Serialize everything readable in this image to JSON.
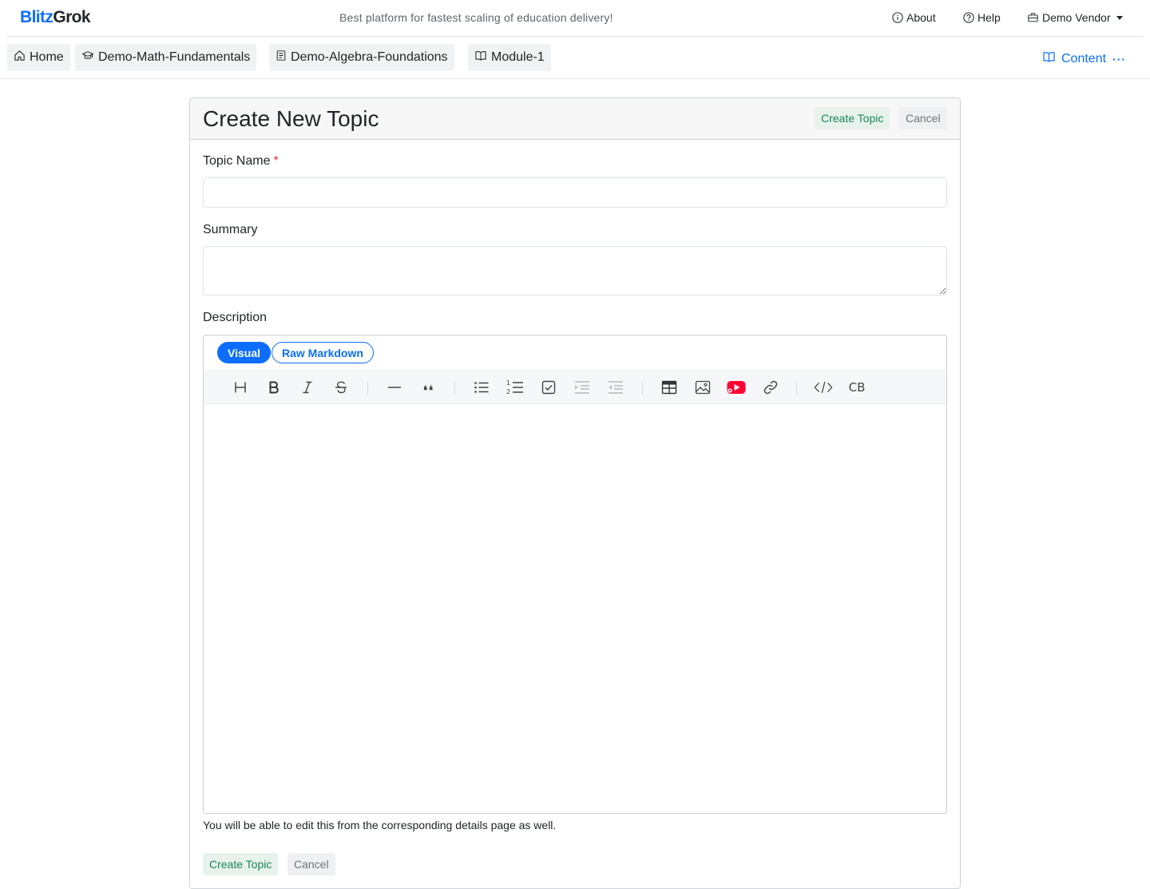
{
  "brand": {
    "part1": "Blitz",
    "part2": "Grok"
  },
  "tagline": "Best platform for fastest scaling of education delivery!",
  "topnav": {
    "about": "About",
    "help": "Help",
    "user": "Demo Vendor"
  },
  "breadcrumbs": [
    "Home",
    "Demo-Math-Fundamentals",
    "Demo-Algebra-Foundations",
    "Module-1"
  ],
  "content_menu": {
    "label": "Content",
    "more": "···"
  },
  "form": {
    "title": "Create New Topic",
    "create_label": "Create Topic",
    "cancel_label": "Cancel",
    "topic_name_label": "Topic Name",
    "required_mark": "*",
    "topic_name_value": "",
    "summary_label": "Summary",
    "summary_value": "",
    "description_label": "Description",
    "help_text": "You will be able to edit this from the corresponding details page as well."
  },
  "editor": {
    "tabs": [
      "Visual",
      "Raw Markdown"
    ],
    "active_tab": "Visual",
    "toolbar_icons": [
      "heading-icon",
      "bold-icon",
      "italic-icon",
      "strike-icon",
      "hr-icon",
      "quote-icon",
      "bullet-list-icon",
      "ordered-list-icon",
      "task-list-icon",
      "indent-icon",
      "outdent-icon",
      "table-icon",
      "image-icon",
      "youtube-icon",
      "link-icon",
      "code-icon",
      "code-block-icon"
    ],
    "code_block_glyph": "CB"
  },
  "colors": {
    "primary": "#0d6efd",
    "success": "#198754",
    "danger": "#dc3545",
    "youtube": "#ff0033"
  }
}
